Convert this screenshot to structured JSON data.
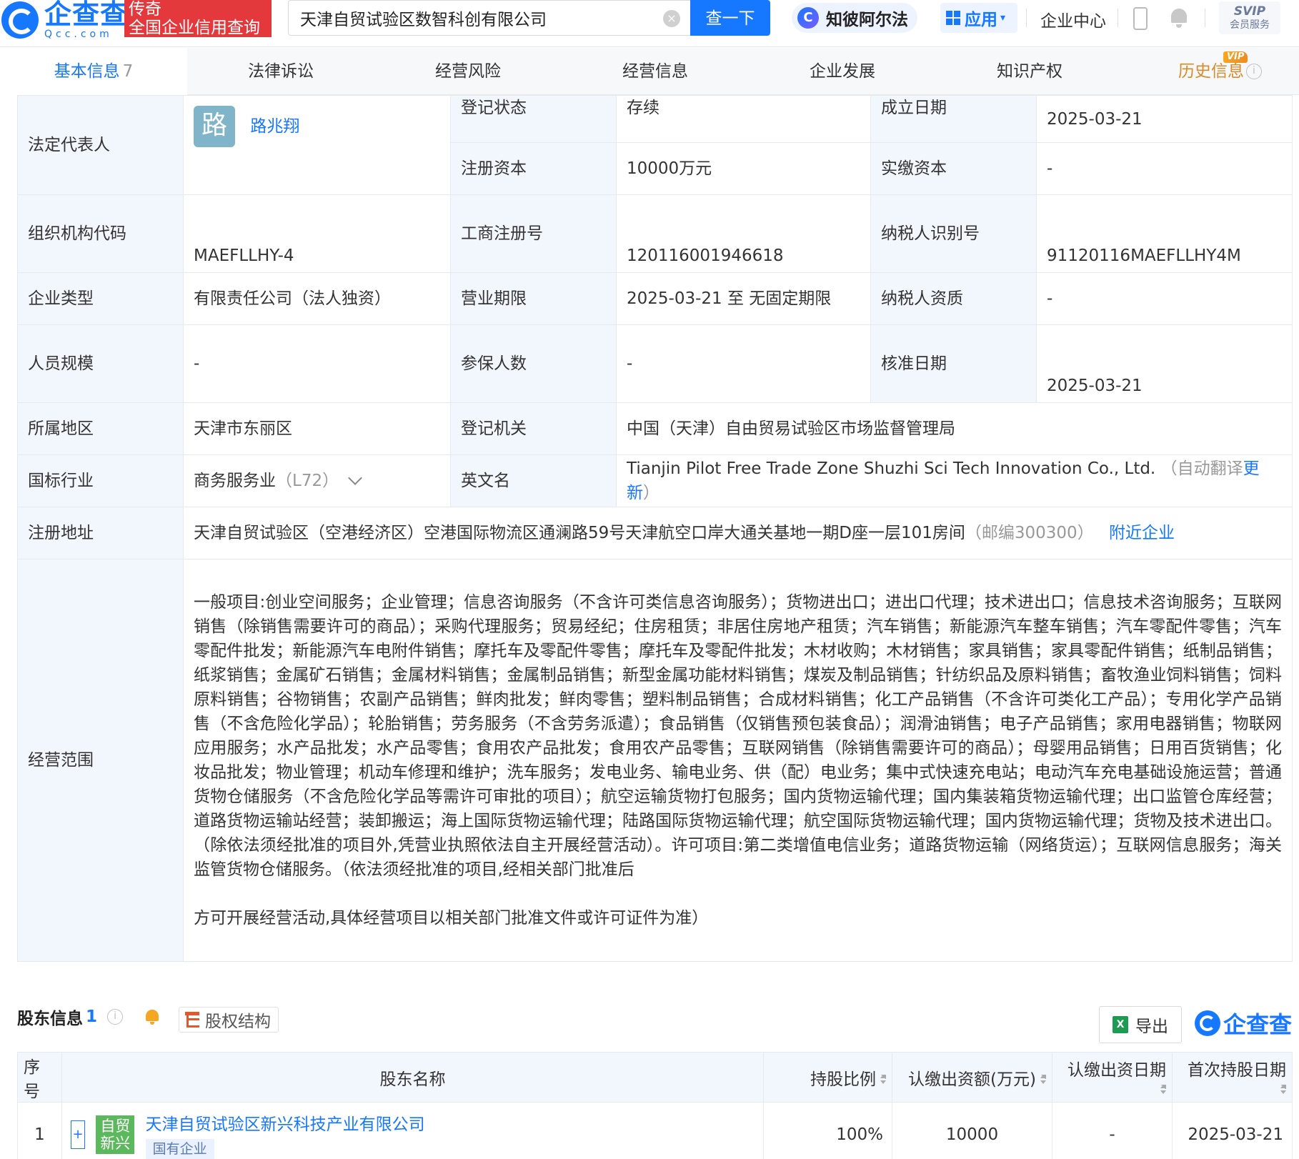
{
  "header": {
    "logo_cn": "企查查",
    "logo_en": "Qcc.com",
    "slogan_line1": "传奇",
    "slogan_line2": "全国企业信用查询",
    "search_value": "天津自贸试验区数智科创有限公司",
    "search_button": "查一下",
    "ai_label": "知彼阿尔法",
    "apps_label": "应用",
    "enterprise_center": "企业中心",
    "svip_line1": "SVIP",
    "svip_line2": "会员服务"
  },
  "tabs": [
    {
      "label": "基本信息",
      "count": "7"
    },
    {
      "label": "法律诉讼"
    },
    {
      "label": "经营风险"
    },
    {
      "label": "经营信息"
    },
    {
      "label": "企业发展"
    },
    {
      "label": "知识产权"
    },
    {
      "label": "历史信息",
      "badge": "VIP"
    }
  ],
  "info": {
    "legal_rep_label": "法定代表人",
    "legal_rep_avatar": "路",
    "legal_rep_name": "路兆翔",
    "reg_status_label": "登记状态",
    "reg_status": "存续",
    "found_date_label": "成立日期",
    "found_date": "2025-03-21",
    "reg_capital_label": "注册资本",
    "reg_capital": "10000万元",
    "paid_capital_label": "实缴资本",
    "paid_capital": "-",
    "org_code_label": "组织机构代码",
    "org_code": "MAEFLLHY-4",
    "biz_reg_no_label": "工商注册号",
    "biz_reg_no": "120116001946618",
    "tax_id_label": "纳税人识别号",
    "tax_id": "91120116MAEFLLHY4M",
    "ent_type_label": "企业类型",
    "ent_type": "有限责任公司（法人独资）",
    "term_label": "营业期限",
    "term": "2025-03-21 至 无固定期限",
    "taxpayer_qual_label": "纳税人资质",
    "taxpayer_qual": "-",
    "staff_label": "人员规模",
    "staff": "-",
    "insured_label": "参保人数",
    "insured": "-",
    "approve_date_label": "核准日期",
    "approve_date": "2025-03-21",
    "region_label": "所属地区",
    "region": "天津市东丽区",
    "authority_label": "登记机关",
    "authority": "中国（天津）自由贸易试验区市场监督管理局",
    "industry_label": "国标行业",
    "industry": "商务服务业",
    "industry_code": "（L72）",
    "en_name_label": "英文名",
    "en_name": "Tianjin Pilot Free Trade Zone Shuzhi Sci Tech Innovation Co., Ltd.",
    "en_name_note_pre": "（自动翻译",
    "en_name_update": "更新",
    "en_name_note_post": "）",
    "address_label": "注册地址",
    "address": "天津自贸试验区（空港经济区）空港国际物流区通澜路59号天津航空口岸大通关基地一期D座一层101房间",
    "postcode": "（邮编300300）",
    "nearby": "附近企业",
    "scope_label": "经营范围",
    "scope": "一般项目:创业空间服务；企业管理；信息咨询服务（不含许可类信息咨询服务）；货物进出口；进出口代理；技术进出口；信息技术咨询服务；互联网销售（除销售需要许可的商品）；采购代理服务；贸易经纪；住房租赁；非居住房地产租赁；汽车销售；新能源汽车整车销售；汽车零配件零售；汽车零配件批发；新能源汽车电附件销售；摩托车及零配件零售；摩托车及零配件批发；木材收购；木材销售；家具销售；家具零配件销售；纸制品销售；纸浆销售；金属矿石销售；金属材料销售；金属制品销售；新型金属功能材料销售；煤炭及制品销售；针纺织品及原料销售；畜牧渔业饲料销售；饲料原料销售；谷物销售；农副产品销售；鲜肉批发；鲜肉零售；塑料制品销售；合成材料销售；化工产品销售（不含许可类化工产品）；专用化学产品销售（不含危险化学品）；轮胎销售；劳务服务（不含劳务派遣）；食品销售（仅销售预包装食品）；润滑油销售；电子产品销售；家用电器销售；物联网应用服务；水产品批发；水产品零售；食用农产品批发；食用农产品零售；互联网销售（除销售需要许可的商品）；母婴用品销售；日用百货销售；化妆品批发；物业管理；机动车修理和维护；洗车服务；发电业务、输电业务、供（配）电业务；集中式快速充电站；电动汽车充电基础设施运营；普通货物仓储服务（不含危险化学品等需许可审批的项目）；航空运输货物打包服务；国内货物运输代理；国内集装箱货物运输代理；出口监管仓库经营；道路货物运输站经营；装卸搬运；海上国际货物运输代理；陆路国际货物运输代理；航空国际货物运输代理；国内货物运输代理；货物及技术进出口。（除依法须经批准的项目外,凭营业执照依法自主开展经营活动）。许可项目:第二类增值电信业务；道路货物运输（网络货运）；互联网信息服务；海关监管货物仓储服务。（依法须经批准的项目,经相关部门批准后",
    "scope_tail": "方可开展经营活动,具体经营项目以相关部门批准文件或许可证件为准）"
  },
  "shareholders": {
    "title": "股东信息",
    "count": "1",
    "structure_button": "股权结构",
    "export_button": "导出",
    "watermark": "企查查",
    "columns": [
      "序号",
      "股东名称",
      "持股比例",
      "认缴出资额(万元)",
      "认缴出资日期",
      "首次持股日期"
    ],
    "rows": [
      {
        "index": "1",
        "logo_line1": "自贸",
        "logo_line2": "新兴",
        "name": "天津自贸试验区新兴科技产业有限公司",
        "tag": "国有企业",
        "ratio": "100%",
        "amount": "10000",
        "sub_date": "-",
        "first_date": "2025-03-21"
      }
    ]
  },
  "colors": {
    "brand": "#1677ff",
    "slogan_bg": "#e4393c",
    "label_bg": "#f2f6fd",
    "history_tab": "#d98b2b"
  }
}
